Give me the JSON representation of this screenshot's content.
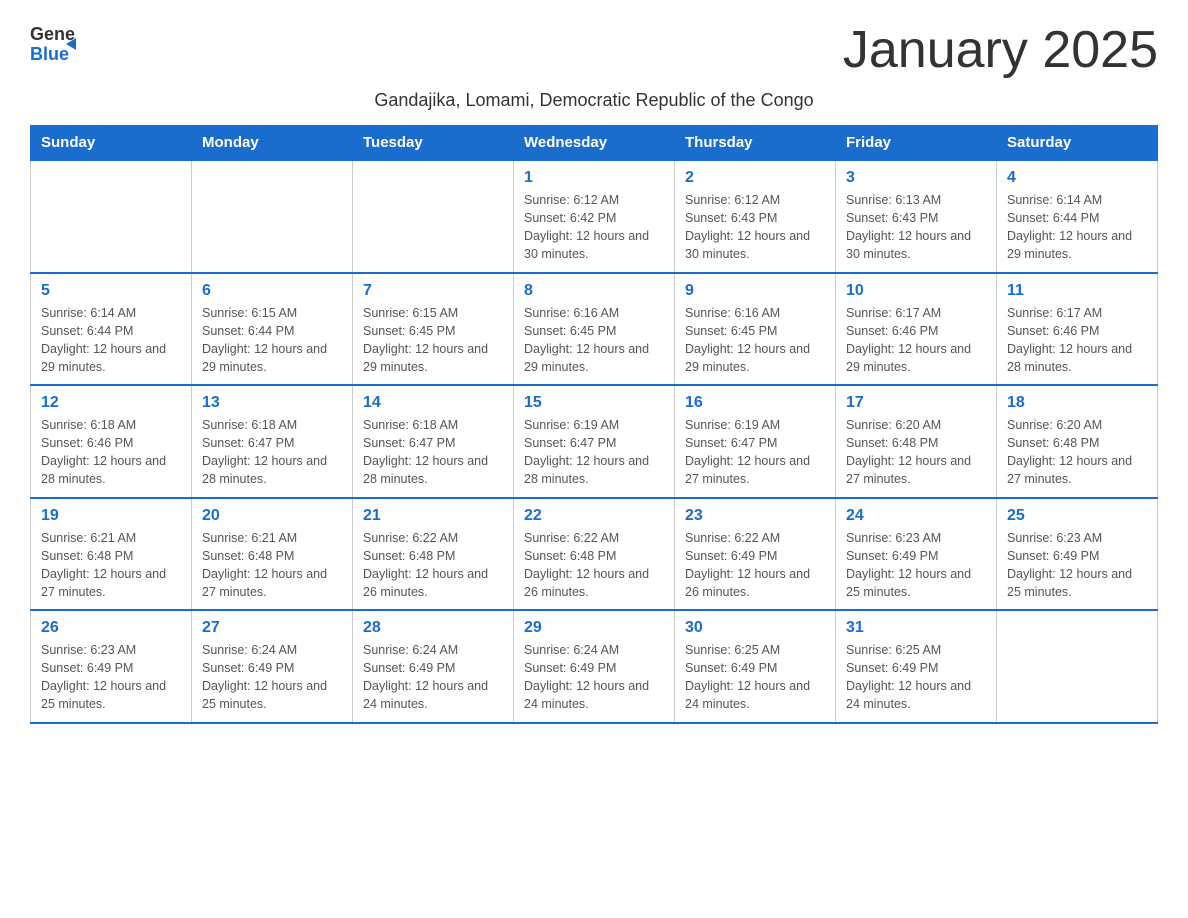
{
  "header": {
    "logo_general": "General",
    "logo_blue": "Blue",
    "month_title": "January 2025",
    "subtitle": "Gandajika, Lomami, Democratic Republic of the Congo"
  },
  "days_of_week": [
    "Sunday",
    "Monday",
    "Tuesday",
    "Wednesday",
    "Thursday",
    "Friday",
    "Saturday"
  ],
  "weeks": [
    [
      {
        "day": "",
        "info": ""
      },
      {
        "day": "",
        "info": ""
      },
      {
        "day": "",
        "info": ""
      },
      {
        "day": "1",
        "info": "Sunrise: 6:12 AM\nSunset: 6:42 PM\nDaylight: 12 hours and 30 minutes."
      },
      {
        "day": "2",
        "info": "Sunrise: 6:12 AM\nSunset: 6:43 PM\nDaylight: 12 hours and 30 minutes."
      },
      {
        "day": "3",
        "info": "Sunrise: 6:13 AM\nSunset: 6:43 PM\nDaylight: 12 hours and 30 minutes."
      },
      {
        "day": "4",
        "info": "Sunrise: 6:14 AM\nSunset: 6:44 PM\nDaylight: 12 hours and 29 minutes."
      }
    ],
    [
      {
        "day": "5",
        "info": "Sunrise: 6:14 AM\nSunset: 6:44 PM\nDaylight: 12 hours and 29 minutes."
      },
      {
        "day": "6",
        "info": "Sunrise: 6:15 AM\nSunset: 6:44 PM\nDaylight: 12 hours and 29 minutes."
      },
      {
        "day": "7",
        "info": "Sunrise: 6:15 AM\nSunset: 6:45 PM\nDaylight: 12 hours and 29 minutes."
      },
      {
        "day": "8",
        "info": "Sunrise: 6:16 AM\nSunset: 6:45 PM\nDaylight: 12 hours and 29 minutes."
      },
      {
        "day": "9",
        "info": "Sunrise: 6:16 AM\nSunset: 6:45 PM\nDaylight: 12 hours and 29 minutes."
      },
      {
        "day": "10",
        "info": "Sunrise: 6:17 AM\nSunset: 6:46 PM\nDaylight: 12 hours and 29 minutes."
      },
      {
        "day": "11",
        "info": "Sunrise: 6:17 AM\nSunset: 6:46 PM\nDaylight: 12 hours and 28 minutes."
      }
    ],
    [
      {
        "day": "12",
        "info": "Sunrise: 6:18 AM\nSunset: 6:46 PM\nDaylight: 12 hours and 28 minutes."
      },
      {
        "day": "13",
        "info": "Sunrise: 6:18 AM\nSunset: 6:47 PM\nDaylight: 12 hours and 28 minutes."
      },
      {
        "day": "14",
        "info": "Sunrise: 6:18 AM\nSunset: 6:47 PM\nDaylight: 12 hours and 28 minutes."
      },
      {
        "day": "15",
        "info": "Sunrise: 6:19 AM\nSunset: 6:47 PM\nDaylight: 12 hours and 28 minutes."
      },
      {
        "day": "16",
        "info": "Sunrise: 6:19 AM\nSunset: 6:47 PM\nDaylight: 12 hours and 27 minutes."
      },
      {
        "day": "17",
        "info": "Sunrise: 6:20 AM\nSunset: 6:48 PM\nDaylight: 12 hours and 27 minutes."
      },
      {
        "day": "18",
        "info": "Sunrise: 6:20 AM\nSunset: 6:48 PM\nDaylight: 12 hours and 27 minutes."
      }
    ],
    [
      {
        "day": "19",
        "info": "Sunrise: 6:21 AM\nSunset: 6:48 PM\nDaylight: 12 hours and 27 minutes."
      },
      {
        "day": "20",
        "info": "Sunrise: 6:21 AM\nSunset: 6:48 PM\nDaylight: 12 hours and 27 minutes."
      },
      {
        "day": "21",
        "info": "Sunrise: 6:22 AM\nSunset: 6:48 PM\nDaylight: 12 hours and 26 minutes."
      },
      {
        "day": "22",
        "info": "Sunrise: 6:22 AM\nSunset: 6:48 PM\nDaylight: 12 hours and 26 minutes."
      },
      {
        "day": "23",
        "info": "Sunrise: 6:22 AM\nSunset: 6:49 PM\nDaylight: 12 hours and 26 minutes."
      },
      {
        "day": "24",
        "info": "Sunrise: 6:23 AM\nSunset: 6:49 PM\nDaylight: 12 hours and 25 minutes."
      },
      {
        "day": "25",
        "info": "Sunrise: 6:23 AM\nSunset: 6:49 PM\nDaylight: 12 hours and 25 minutes."
      }
    ],
    [
      {
        "day": "26",
        "info": "Sunrise: 6:23 AM\nSunset: 6:49 PM\nDaylight: 12 hours and 25 minutes."
      },
      {
        "day": "27",
        "info": "Sunrise: 6:24 AM\nSunset: 6:49 PM\nDaylight: 12 hours and 25 minutes."
      },
      {
        "day": "28",
        "info": "Sunrise: 6:24 AM\nSunset: 6:49 PM\nDaylight: 12 hours and 24 minutes."
      },
      {
        "day": "29",
        "info": "Sunrise: 6:24 AM\nSunset: 6:49 PM\nDaylight: 12 hours and 24 minutes."
      },
      {
        "day": "30",
        "info": "Sunrise: 6:25 AM\nSunset: 6:49 PM\nDaylight: 12 hours and 24 minutes."
      },
      {
        "day": "31",
        "info": "Sunrise: 6:25 AM\nSunset: 6:49 PM\nDaylight: 12 hours and 24 minutes."
      },
      {
        "day": "",
        "info": ""
      }
    ]
  ]
}
